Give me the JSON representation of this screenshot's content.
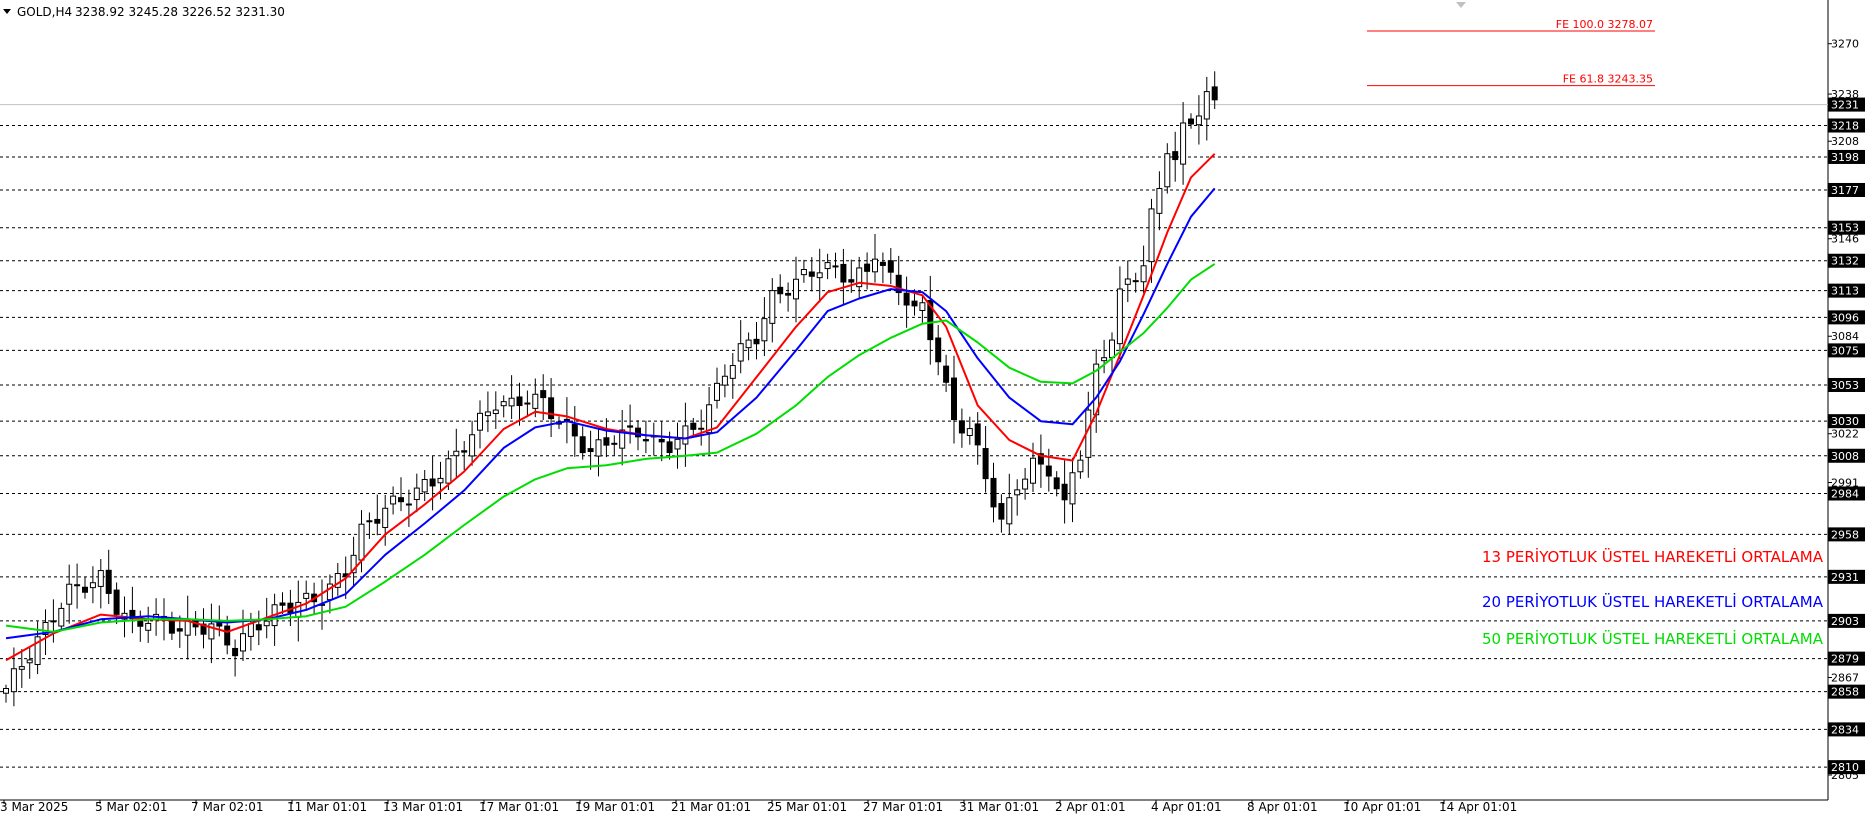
{
  "header": {
    "symbol": "GOLD,H4",
    "ohlc": "3238.92 3245.28 3226.52 3231.30"
  },
  "chart_data": {
    "type": "candlestick",
    "ylim": [
      2805,
      3280
    ],
    "axis_ticks": [
      3270,
      3238,
      3208,
      3146,
      3084,
      3022,
      2991,
      2867,
      2805
    ],
    "levels": [
      {
        "value": 3218,
        "label": "3218"
      },
      {
        "value": 3198,
        "label": "3198"
      },
      {
        "value": 3177,
        "label": "3177"
      },
      {
        "value": 3153,
        "label": "3153"
      },
      {
        "value": 3132,
        "label": "3132"
      },
      {
        "value": 3113,
        "label": "3113"
      },
      {
        "value": 3096,
        "label": "3096"
      },
      {
        "value": 3075,
        "label": "3075"
      },
      {
        "value": 3053,
        "label": "3053"
      },
      {
        "value": 3030,
        "label": "3030"
      },
      {
        "value": 3008,
        "label": "3008"
      },
      {
        "value": 2984,
        "label": "2984"
      },
      {
        "value": 2958,
        "label": "2958"
      },
      {
        "value": 2931,
        "label": "2931"
      },
      {
        "value": 2903,
        "label": "2903"
      },
      {
        "value": 2879,
        "label": "2879"
      },
      {
        "value": 2858,
        "label": "2858"
      },
      {
        "value": 2834,
        "label": "2834"
      },
      {
        "value": 2810,
        "label": "2810"
      }
    ],
    "current_price": {
      "value": 3231.3,
      "label": "3231"
    },
    "fib_levels": [
      {
        "value": 3278.07,
        "label": "FE 100.0 3278.07"
      },
      {
        "value": 3243.35,
        "label": "FE 61.8 3243.35"
      }
    ],
    "x_labels": [
      "3 Mar 2025",
      "5 Mar 02:01",
      "7 Mar 02:01",
      "11 Mar 01:01",
      "13 Mar 01:01",
      "17 Mar 01:01",
      "19 Mar 01:01",
      "21 Mar 01:01",
      "25 Mar 01:01",
      "27 Mar 01:01",
      "31 Mar 01:01",
      "2 Apr 01:01",
      "4 Apr 01:01",
      "8 Apr 01:01",
      "10 Apr 01:01",
      "14 Apr 01:01"
    ],
    "price_path": [
      [
        0,
        2860
      ],
      [
        5,
        2898
      ],
      [
        8,
        2922
      ],
      [
        12,
        2930
      ],
      [
        14,
        2912
      ],
      [
        16,
        2900
      ],
      [
        18,
        2905
      ],
      [
        22,
        2898
      ],
      [
        26,
        2900
      ],
      [
        29,
        2885
      ],
      [
        31,
        2898
      ],
      [
        35,
        2912
      ],
      [
        40,
        2918
      ],
      [
        43,
        2935
      ],
      [
        45,
        2960
      ],
      [
        48,
        2975
      ],
      [
        51,
        2982
      ],
      [
        54,
        2992
      ],
      [
        56,
        3002
      ],
      [
        58,
        3015
      ],
      [
        60,
        3030
      ],
      [
        62,
        3042
      ],
      [
        64,
        3040
      ],
      [
        66,
        3045
      ],
      [
        68,
        3042
      ],
      [
        70,
        3030
      ],
      [
        72,
        3020
      ],
      [
        74,
        3010
      ],
      [
        77,
        3020
      ],
      [
        80,
        3024
      ],
      [
        82,
        3016
      ],
      [
        84,
        3015
      ],
      [
        86,
        3022
      ],
      [
        88,
        3030
      ],
      [
        89,
        3038
      ],
      [
        91,
        3062
      ],
      [
        93,
        3075
      ],
      [
        95,
        3084
      ],
      [
        97,
        3108
      ],
      [
        99,
        3115
      ],
      [
        101,
        3122
      ],
      [
        103,
        3128
      ],
      [
        105,
        3126
      ],
      [
        107,
        3120
      ],
      [
        109,
        3125
      ],
      [
        110,
        3138
      ],
      [
        111,
        3128
      ],
      [
        112,
        3120
      ],
      [
        114,
        3108
      ],
      [
        115,
        3100
      ],
      [
        116,
        3102
      ],
      [
        118,
        3070
      ],
      [
        120,
        3030
      ],
      [
        122,
        3025
      ],
      [
        124,
        2995
      ],
      [
        126,
        2965
      ],
      [
        128,
        2990
      ],
      [
        130,
        3002
      ],
      [
        132,
        3000
      ],
      [
        134,
        2975
      ],
      [
        135,
        2998
      ],
      [
        136,
        3010
      ],
      [
        137,
        3035
      ],
      [
        138,
        3062
      ],
      [
        140,
        3085
      ],
      [
        141,
        3110
      ],
      [
        142,
        3118
      ],
      [
        144,
        3130
      ],
      [
        145,
        3160
      ],
      [
        146,
        3178
      ],
      [
        147,
        3205
      ],
      [
        148,
        3195
      ],
      [
        149,
        3215
      ],
      [
        151,
        3228
      ],
      [
        152,
        3236
      ],
      [
        153,
        3231.3
      ]
    ],
    "series": [
      {
        "name": "13 PERİYOTLUK ÜSTEL HAREKETLİ ORTALAMA",
        "color": "#ff0000",
        "values": [
          [
            0,
            2878
          ],
          [
            6,
            2895
          ],
          [
            12,
            2907
          ],
          [
            18,
            2904
          ],
          [
            23,
            2903
          ],
          [
            28,
            2896
          ],
          [
            33,
            2905
          ],
          [
            38,
            2914
          ],
          [
            43,
            2930
          ],
          [
            48,
            2958
          ],
          [
            53,
            2977
          ],
          [
            58,
            2998
          ],
          [
            63,
            3025
          ],
          [
            67,
            3036
          ],
          [
            71,
            3033
          ],
          [
            76,
            3025
          ],
          [
            81,
            3021
          ],
          [
            86,
            3019
          ],
          [
            90,
            3026
          ],
          [
            95,
            3058
          ],
          [
            100,
            3090
          ],
          [
            104,
            3112
          ],
          [
            108,
            3118
          ],
          [
            112,
            3116
          ],
          [
            116,
            3110
          ],
          [
            119,
            3090
          ],
          [
            123,
            3040
          ],
          [
            127,
            3018
          ],
          [
            131,
            3008
          ],
          [
            135,
            3005
          ],
          [
            138,
            3035
          ],
          [
            141,
            3072
          ],
          [
            144,
            3110
          ],
          [
            147,
            3150
          ],
          [
            150,
            3185
          ],
          [
            153,
            3200
          ]
        ]
      },
      {
        "name": "20 PERİYOTLUK ÜSTEL HAREKETLİ ORTALAMA",
        "color": "#0000ff",
        "values": [
          [
            0,
            2892
          ],
          [
            6,
            2896
          ],
          [
            12,
            2904
          ],
          [
            18,
            2906
          ],
          [
            23,
            2904
          ],
          [
            28,
            2902
          ],
          [
            33,
            2904
          ],
          [
            38,
            2910
          ],
          [
            43,
            2920
          ],
          [
            48,
            2945
          ],
          [
            53,
            2965
          ],
          [
            58,
            2986
          ],
          [
            63,
            3013
          ],
          [
            67,
            3026
          ],
          [
            71,
            3030
          ],
          [
            76,
            3024
          ],
          [
            81,
            3021
          ],
          [
            86,
            3019
          ],
          [
            90,
            3023
          ],
          [
            95,
            3045
          ],
          [
            100,
            3075
          ],
          [
            104,
            3100
          ],
          [
            108,
            3108
          ],
          [
            112,
            3114
          ],
          [
            116,
            3112
          ],
          [
            119,
            3100
          ],
          [
            123,
            3070
          ],
          [
            127,
            3045
          ],
          [
            131,
            3030
          ],
          [
            135,
            3028
          ],
          [
            138,
            3045
          ],
          [
            141,
            3068
          ],
          [
            144,
            3098
          ],
          [
            147,
            3130
          ],
          [
            150,
            3160
          ],
          [
            153,
            3178
          ]
        ]
      },
      {
        "name": "50 PERİYOTLUK ÜSTEL HAREKETLİ ORTALAMA",
        "color": "#00dd00",
        "values": [
          [
            0,
            2900
          ],
          [
            6,
            2896
          ],
          [
            12,
            2902
          ],
          [
            18,
            2904
          ],
          [
            23,
            2904
          ],
          [
            28,
            2903
          ],
          [
            33,
            2904
          ],
          [
            38,
            2906
          ],
          [
            43,
            2912
          ],
          [
            48,
            2928
          ],
          [
            53,
            2945
          ],
          [
            58,
            2964
          ],
          [
            63,
            2982
          ],
          [
            67,
            2993
          ],
          [
            71,
            3000
          ],
          [
            76,
            3002
          ],
          [
            81,
            3006
          ],
          [
            86,
            3008
          ],
          [
            90,
            3010
          ],
          [
            95,
            3022
          ],
          [
            100,
            3040
          ],
          [
            104,
            3058
          ],
          [
            108,
            3072
          ],
          [
            112,
            3083
          ],
          [
            116,
            3092
          ],
          [
            119,
            3094
          ],
          [
            123,
            3080
          ],
          [
            127,
            3064
          ],
          [
            131,
            3055
          ],
          [
            135,
            3054
          ],
          [
            138,
            3062
          ],
          [
            141,
            3074
          ],
          [
            144,
            3086
          ],
          [
            147,
            3102
          ],
          [
            150,
            3120
          ],
          [
            153,
            3130
          ]
        ]
      }
    ],
    "legend_placement": "right"
  },
  "legend": {
    "ema13": "13 PERİYOTLUK ÜSTEL HAREKETLİ ORTALAMA",
    "ema20": "20 PERİYOTLUK ÜSTEL HAREKETLİ ORTALAMA",
    "ema50": "50 PERİYOTLUK ÜSTEL HAREKETLİ ORTALAMA"
  },
  "colors": {
    "ema13": "#ff0000",
    "ema20": "#0000ff",
    "ema50": "#00dd00",
    "fib": "#ff0000",
    "candle": "#000000"
  }
}
